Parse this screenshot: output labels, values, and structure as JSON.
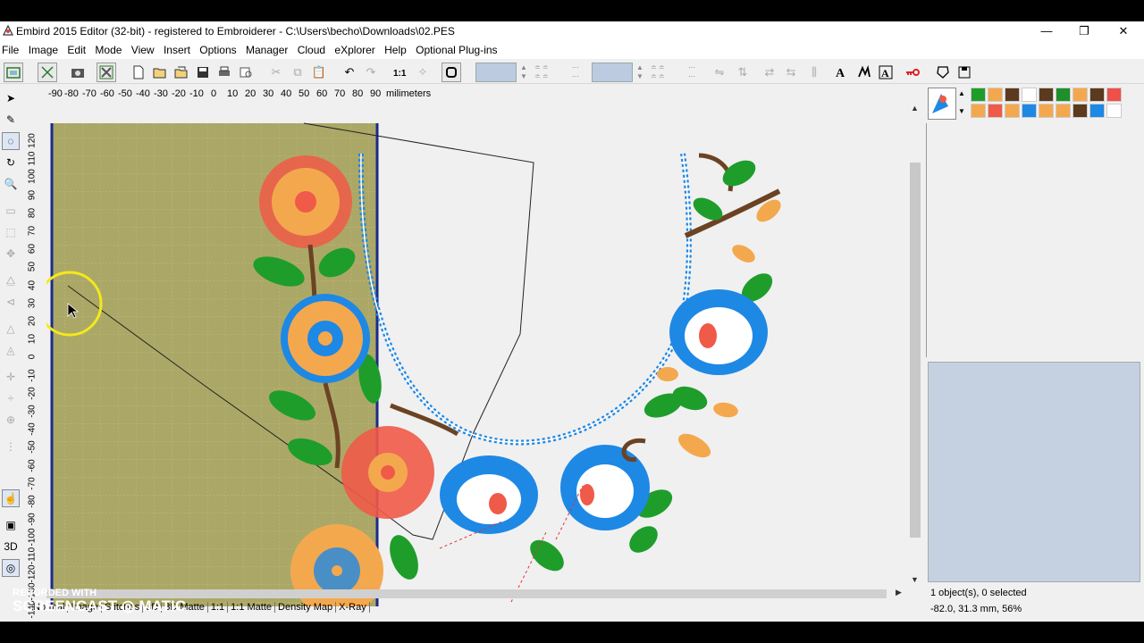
{
  "window": {
    "title": "Embird 2015 Editor (32-bit) - registered to Embroiderer - C:\\Users\\becho\\Downloads\\02.PES",
    "minimize": "—",
    "restore": "❐",
    "close": "✕"
  },
  "menu": [
    "File",
    "Image",
    "Edit",
    "Mode",
    "View",
    "Insert",
    "Options",
    "Manager",
    "Cloud",
    "eXplorer",
    "Help",
    "Optional Plug-ins"
  ],
  "ruler": {
    "x_ticks": [
      "-90",
      "-80",
      "-70",
      "-60",
      "-50",
      "-40",
      "-30",
      "-20",
      "-10",
      "0",
      "10",
      "20",
      "30",
      "40",
      "50",
      "60",
      "70",
      "80",
      "90"
    ],
    "unit": "milimeters",
    "y_ticks": [
      "120",
      "110",
      "100",
      "90",
      "80",
      "70",
      "60",
      "50",
      "40",
      "30",
      "20",
      "10",
      "0",
      "-10",
      "-20",
      "-30",
      "-40",
      "-50",
      "-60",
      "-70",
      "-80",
      "-90",
      "-100",
      "-110",
      "-120",
      "-130",
      "-140"
    ]
  },
  "view_tabs": [
    "Normal",
    "Image",
    "Stitches",
    "3D",
    "3D Matte",
    "1:1",
    "1:1 Matte",
    "Density Map",
    "X-Ray"
  ],
  "status": {
    "selection": "1 object(s), 0 selected",
    "coords": "-82.0, 31.3 mm, 56%"
  },
  "watermark": {
    "line1": "RECORDED WITH",
    "line2": "SCREENCAST",
    "line3": "MATIC"
  },
  "palette_colors": [
    "#1e9d2b",
    "#f4a84e",
    "#5b3a1e",
    "#ffffff",
    "#5b3a1e",
    "#1e8f2a",
    "#f4a84e",
    "#5b3a1e",
    "#f0504a",
    "#f4a84e",
    "#f05a48",
    "#f4a84e",
    "#1e88e5",
    "#f4a84e",
    "#f4a84e",
    "#5b3a1e",
    "#1e88e5",
    "#ffffff"
  ],
  "colors": {
    "hoop_fill": "#aba867",
    "hoop_border": "#1a2a8a",
    "orange": "#f4a84e",
    "red": "#f05a48",
    "blue": "#1e88e5",
    "green": "#1e9d2b",
    "brown": "#6b4323"
  }
}
